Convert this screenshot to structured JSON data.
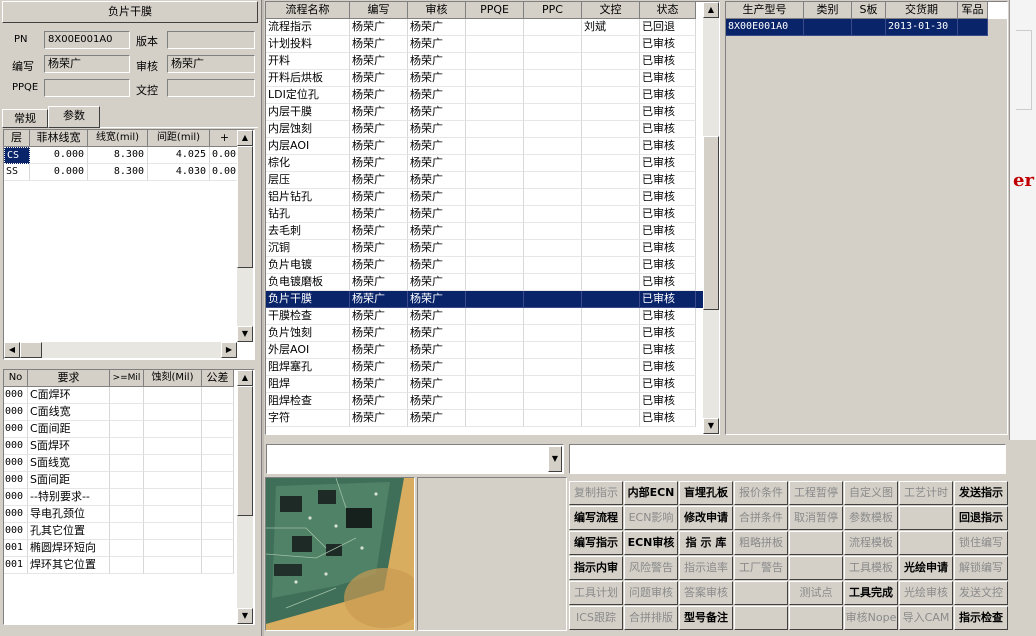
{
  "left": {
    "title": "负片干膜",
    "pn_label": "PN",
    "pn_value": "8X00E001A0",
    "version_label": "版本",
    "version_value": "",
    "writer_label": "编写",
    "writer_value": "杨荣广",
    "audit_label": "审核",
    "audit_value": "杨荣广",
    "ppqe_label": "PPQE",
    "ppqe_value": "",
    "doc_label": "文控",
    "doc_value": "",
    "tabs": [
      {
        "label": "常规"
      },
      {
        "label": "参数"
      }
    ],
    "param_headers": [
      "层",
      "菲林线宽",
      "线宽(mil)",
      "间距(mil)",
      "+"
    ],
    "param_rows": [
      {
        "layer": "CS",
        "film": "0.000",
        "width": "8.300",
        "space": "4.025",
        "plus": "0.00"
      },
      {
        "layer": "SS",
        "film": "0.000",
        "width": "8.300",
        "space": "4.030",
        "plus": "0.00"
      }
    ],
    "req_headers": [
      "No",
      "要求",
      ">=Mil",
      "蚀刻(Mil)",
      "公差"
    ],
    "req_rows": [
      {
        "no": "000",
        "text": "C面焊环"
      },
      {
        "no": "000",
        "text": "C面线宽"
      },
      {
        "no": "000",
        "text": "C面间距"
      },
      {
        "no": "000",
        "text": "S面焊环"
      },
      {
        "no": "000",
        "text": "S面线宽"
      },
      {
        "no": "000",
        "text": "S面间距"
      },
      {
        "no": "000",
        "text": "--特别要求--"
      },
      {
        "no": "000",
        "text": "导电孔颈位"
      },
      {
        "no": "000",
        "text": "孔其它位置"
      },
      {
        "no": "001",
        "text": "椭圆焊环短向"
      },
      {
        "no": "001",
        "text": "焊环其它位置"
      }
    ]
  },
  "flow": {
    "headers": [
      "流程名称",
      "编写",
      "审核",
      "PPQE",
      "PPC",
      "文控",
      "状态"
    ],
    "rows": [
      {
        "name": "流程指示",
        "writer": "杨荣广",
        "audit": "杨荣广",
        "ppqe": "",
        "ppc": "",
        "doc": "刘斌",
        "status": "已回退"
      },
      {
        "name": "计划投料",
        "writer": "杨荣广",
        "audit": "杨荣广",
        "ppqe": "",
        "ppc": "",
        "doc": "",
        "status": "已审核"
      },
      {
        "name": "开料",
        "writer": "杨荣广",
        "audit": "杨荣广",
        "ppqe": "",
        "ppc": "",
        "doc": "",
        "status": "已审核"
      },
      {
        "name": "开料后烘板",
        "writer": "杨荣广",
        "audit": "杨荣广",
        "ppqe": "",
        "ppc": "",
        "doc": "",
        "status": "已审核"
      },
      {
        "name": "LDI定位孔",
        "writer": "杨荣广",
        "audit": "杨荣广",
        "ppqe": "",
        "ppc": "",
        "doc": "",
        "status": "已审核"
      },
      {
        "name": "内层干膜",
        "writer": "杨荣广",
        "audit": "杨荣广",
        "ppqe": "",
        "ppc": "",
        "doc": "",
        "status": "已审核"
      },
      {
        "name": "内层蚀刻",
        "writer": "杨荣广",
        "audit": "杨荣广",
        "ppqe": "",
        "ppc": "",
        "doc": "",
        "status": "已审核"
      },
      {
        "name": "内层AOI",
        "writer": "杨荣广",
        "audit": "杨荣广",
        "ppqe": "",
        "ppc": "",
        "doc": "",
        "status": "已审核"
      },
      {
        "name": "棕化",
        "writer": "杨荣广",
        "audit": "杨荣广",
        "ppqe": "",
        "ppc": "",
        "doc": "",
        "status": "已审核"
      },
      {
        "name": "层压",
        "writer": "杨荣广",
        "audit": "杨荣广",
        "ppqe": "",
        "ppc": "",
        "doc": "",
        "status": "已审核"
      },
      {
        "name": "铝片钻孔",
        "writer": "杨荣广",
        "audit": "杨荣广",
        "ppqe": "",
        "ppc": "",
        "doc": "",
        "status": "已审核"
      },
      {
        "name": "钻孔",
        "writer": "杨荣广",
        "audit": "杨荣广",
        "ppqe": "",
        "ppc": "",
        "doc": "",
        "status": "已审核"
      },
      {
        "name": "去毛刺",
        "writer": "杨荣广",
        "audit": "杨荣广",
        "ppqe": "",
        "ppc": "",
        "doc": "",
        "status": "已审核"
      },
      {
        "name": "沉铜",
        "writer": "杨荣广",
        "audit": "杨荣广",
        "ppqe": "",
        "ppc": "",
        "doc": "",
        "status": "已审核"
      },
      {
        "name": "负片电镀",
        "writer": "杨荣广",
        "audit": "杨荣广",
        "ppqe": "",
        "ppc": "",
        "doc": "",
        "status": "已审核"
      },
      {
        "name": "负电镀磨板",
        "writer": "杨荣广",
        "audit": "杨荣广",
        "ppqe": "",
        "ppc": "",
        "doc": "",
        "status": "已审核"
      },
      {
        "name": "负片干膜",
        "writer": "杨荣广",
        "audit": "杨荣广",
        "ppqe": "",
        "ppc": "",
        "doc": "",
        "status": "已审核"
      },
      {
        "name": "干膜检查",
        "writer": "杨荣广",
        "audit": "杨荣广",
        "ppqe": "",
        "ppc": "",
        "doc": "",
        "status": "已审核"
      },
      {
        "name": "负片蚀刻",
        "writer": "杨荣广",
        "audit": "杨荣广",
        "ppqe": "",
        "ppc": "",
        "doc": "",
        "status": "已审核"
      },
      {
        "name": "外层AOI",
        "writer": "杨荣广",
        "audit": "杨荣广",
        "ppqe": "",
        "ppc": "",
        "doc": "",
        "status": "已审核"
      },
      {
        "name": "阻焊塞孔",
        "writer": "杨荣广",
        "audit": "杨荣广",
        "ppqe": "",
        "ppc": "",
        "doc": "",
        "status": "已审核"
      },
      {
        "name": "阻焊",
        "writer": "杨荣广",
        "audit": "杨荣广",
        "ppqe": "",
        "ppc": "",
        "doc": "",
        "status": "已审核"
      },
      {
        "name": "阻焊检查",
        "writer": "杨荣广",
        "audit": "杨荣广",
        "ppqe": "",
        "ppc": "",
        "doc": "",
        "status": "已审核"
      },
      {
        "name": "字符",
        "writer": "杨荣广",
        "audit": "杨荣广",
        "ppqe": "",
        "ppc": "",
        "doc": "",
        "status": "已审核"
      }
    ],
    "selected_index": 16
  },
  "order": {
    "headers": [
      "生产型号",
      "类别",
      "S板",
      "交货期",
      "军品"
    ],
    "rows": [
      {
        "model": "8X00E001A0",
        "category": "",
        "sboard": "",
        "delivery": "2013-01-30",
        "military": ""
      }
    ]
  },
  "buttons": [
    [
      {
        "label": "复制指示",
        "enabled": false
      },
      {
        "label": "内部ECN",
        "enabled": true
      },
      {
        "label": "盲埋孔板",
        "enabled": true
      },
      {
        "label": "报价条件",
        "enabled": false
      },
      {
        "label": "工程暂停",
        "enabled": false
      },
      {
        "label": "自定义图",
        "enabled": false
      },
      {
        "label": "工艺计时",
        "enabled": false
      },
      {
        "label": "发送指示",
        "enabled": true
      }
    ],
    [
      {
        "label": "编写流程",
        "enabled": true
      },
      {
        "label": "ECN影响",
        "enabled": false
      },
      {
        "label": "修改申请",
        "enabled": true
      },
      {
        "label": "合拼条件",
        "enabled": false
      },
      {
        "label": "取消暂停",
        "enabled": false
      },
      {
        "label": "参数模板",
        "enabled": false
      },
      {
        "label": "",
        "enabled": false
      },
      {
        "label": "回退指示",
        "enabled": true
      }
    ],
    [
      {
        "label": "编写指示",
        "enabled": true
      },
      {
        "label": "ECN审核",
        "enabled": true
      },
      {
        "label": "指 示 库",
        "enabled": true
      },
      {
        "label": "粗略拼板",
        "enabled": false
      },
      {
        "label": "",
        "enabled": false
      },
      {
        "label": "流程模板",
        "enabled": false
      },
      {
        "label": "",
        "enabled": false
      },
      {
        "label": "锁住编写",
        "enabled": false
      }
    ],
    [
      {
        "label": "指示内审",
        "enabled": true
      },
      {
        "label": "风险警告",
        "enabled": false
      },
      {
        "label": "指示追率",
        "enabled": false
      },
      {
        "label": "工厂警告",
        "enabled": false
      },
      {
        "label": "",
        "enabled": false
      },
      {
        "label": "工具模板",
        "enabled": false
      },
      {
        "label": "光绘申请",
        "enabled": true
      },
      {
        "label": "解锁编写",
        "enabled": false
      }
    ],
    [
      {
        "label": "工具计划",
        "enabled": false
      },
      {
        "label": "问题审核",
        "enabled": false
      },
      {
        "label": "答案审核",
        "enabled": false
      },
      {
        "label": "",
        "enabled": false
      },
      {
        "label": "测试点",
        "enabled": false
      },
      {
        "label": "工具完成",
        "enabled": true
      },
      {
        "label": "光绘审核",
        "enabled": false
      },
      {
        "label": "发送文控",
        "enabled": false
      }
    ],
    [
      {
        "label": "ICS跟踪",
        "enabled": false
      },
      {
        "label": "合拼排版",
        "enabled": false
      },
      {
        "label": "型号备注",
        "enabled": true
      },
      {
        "label": "",
        "enabled": false
      },
      {
        "label": "",
        "enabled": false
      },
      {
        "label": "审核Nope",
        "enabled": false
      },
      {
        "label": "导入CAM",
        "enabled": false
      },
      {
        "label": "指示检查",
        "enabled": true
      }
    ]
  ],
  "right_edge_text": "er",
  "colors": {
    "selection": "#0a246a",
    "face": "#d4d0c8"
  }
}
